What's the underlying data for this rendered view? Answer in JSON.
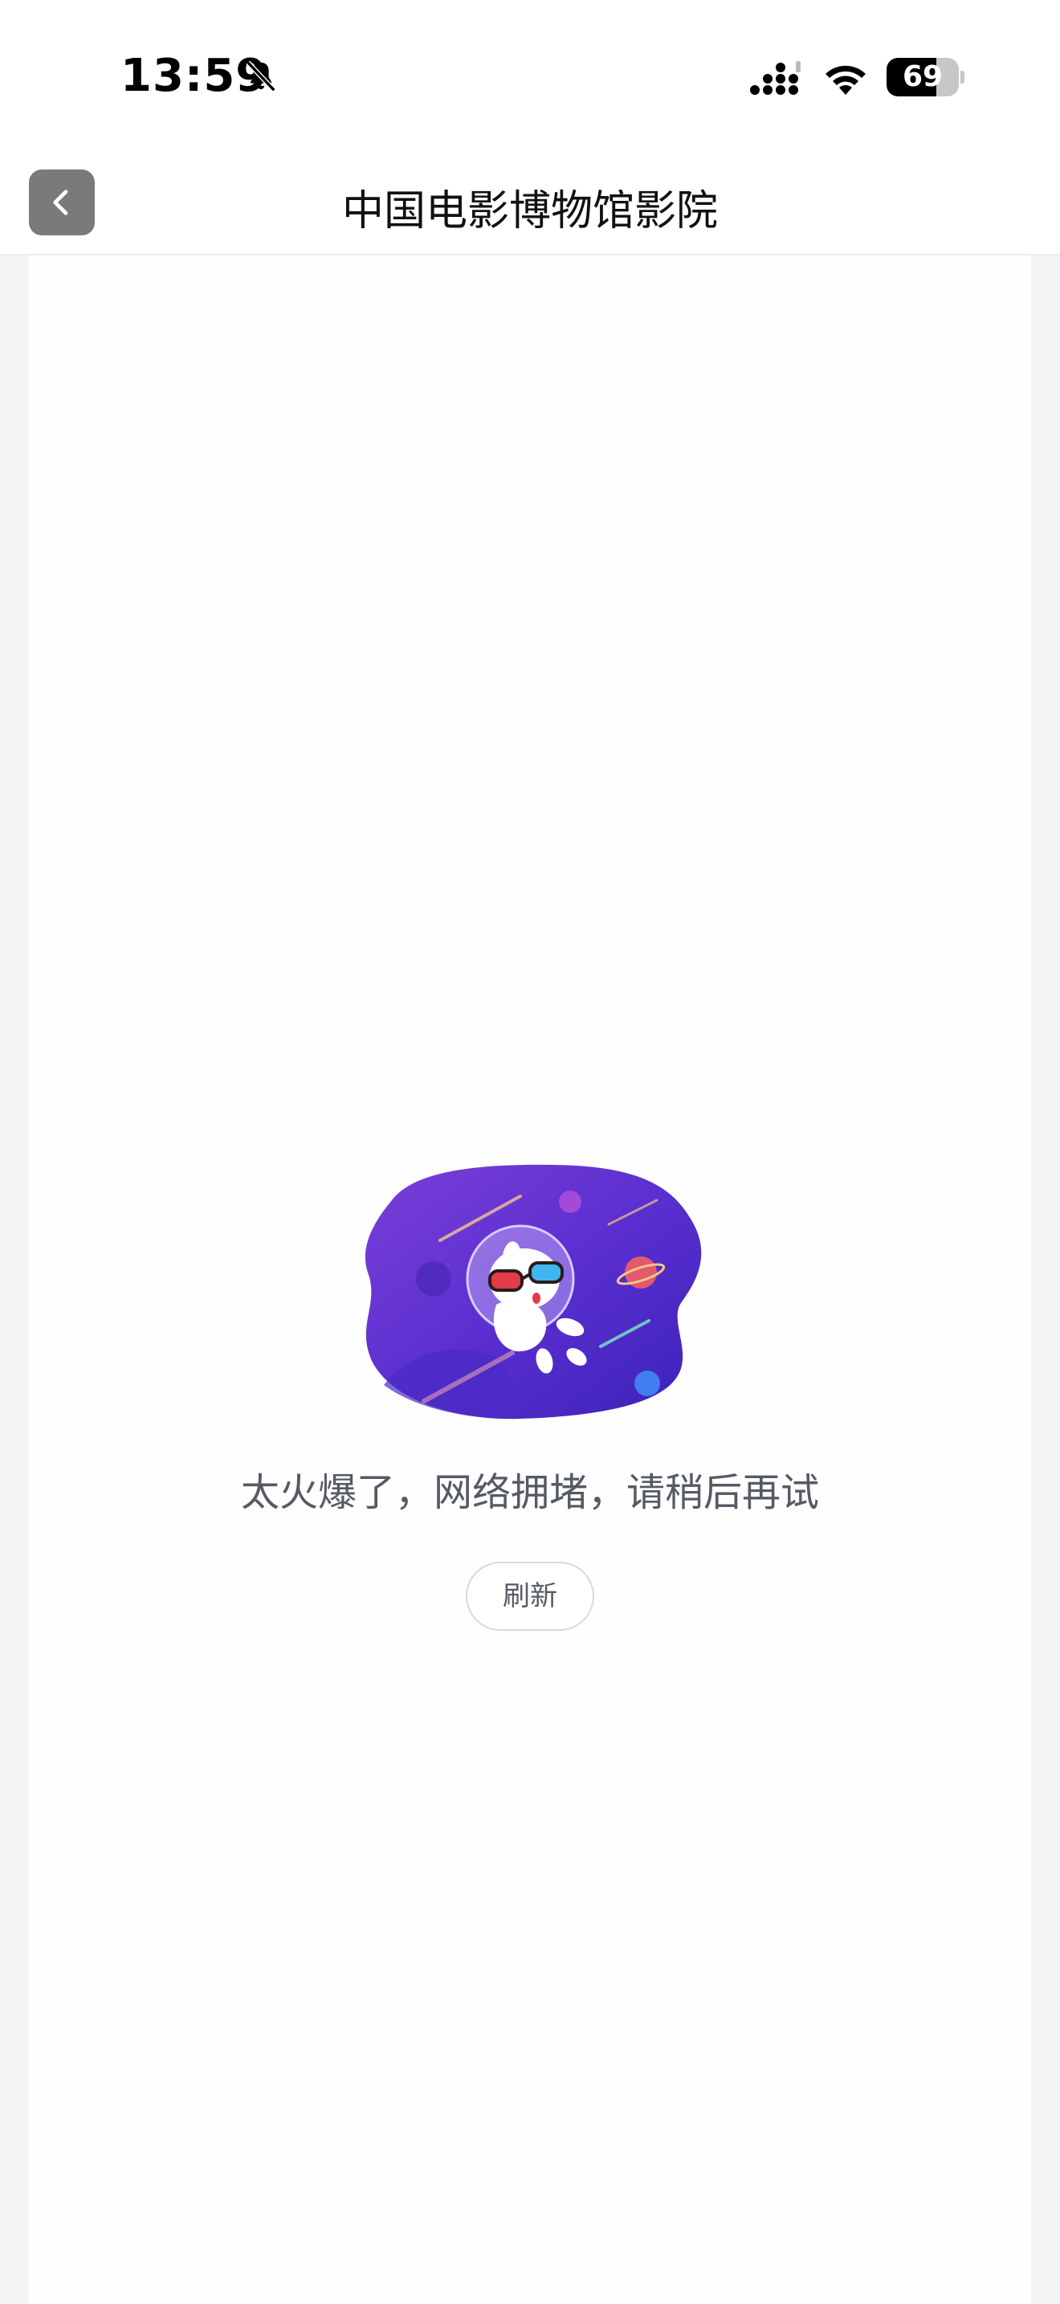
{
  "status_bar": {
    "time": "13:59",
    "battery_level": "69",
    "battery_fraction": 0.69,
    "icons": [
      "bell-off-icon",
      "signal-icon",
      "wifi-icon",
      "battery-icon"
    ]
  },
  "nav": {
    "title": "中国电影博物馆影院",
    "back_icon": "chevron-left-icon"
  },
  "error": {
    "illustration": "astronaut-space-illustration",
    "message": "太火爆了，网络拥堵，请稍后再试",
    "refresh_label": "刷新"
  },
  "colors": {
    "illustration_purple": "#5b2fd0",
    "back_button_bg": "#7a7a7a",
    "message_text": "#555a63"
  }
}
